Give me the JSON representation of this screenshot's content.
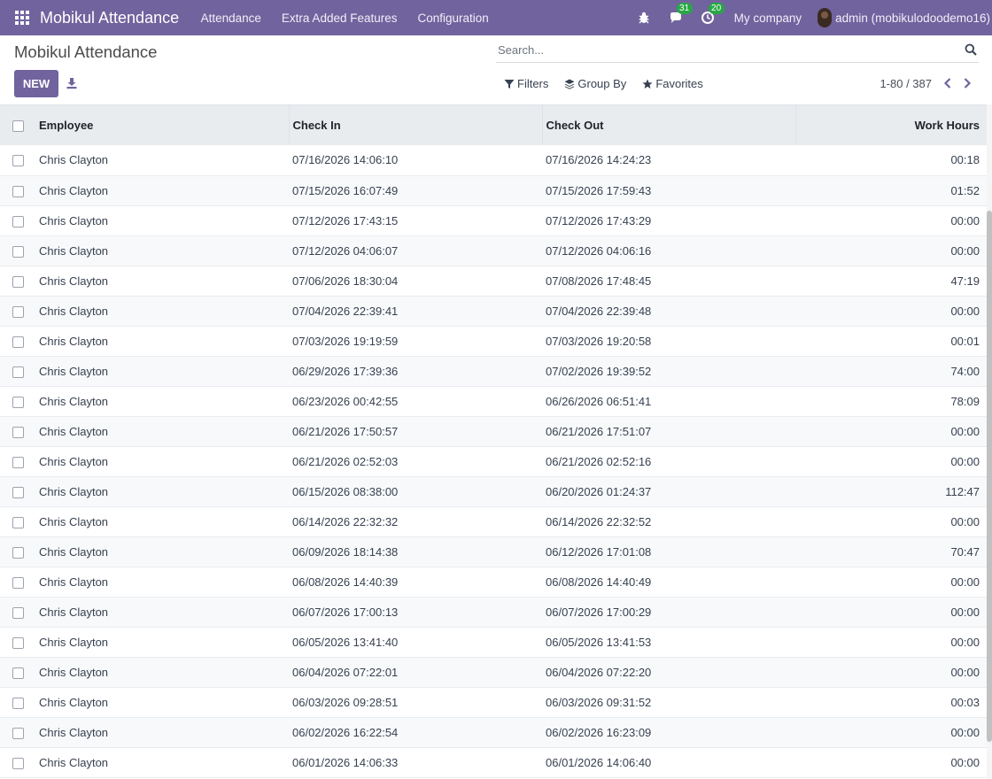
{
  "navbar": {
    "brand": "Mobikul Attendance",
    "menu": [
      "Attendance",
      "Extra Added Features",
      "Configuration"
    ],
    "messages_badge": "31",
    "activities_badge": "20",
    "company": "My company",
    "user": "admin (mobikulodoodemo16)",
    "icons": [
      "apps-grid-icon",
      "bug-icon",
      "chat-icon",
      "clock-icon"
    ],
    "color": "#71639e"
  },
  "control_panel": {
    "title": "Mobikul Attendance",
    "new_label": "NEW",
    "search_placeholder": "Search...",
    "filters_label": "Filters",
    "group_by_label": "Group By",
    "favorites_label": "Favorites",
    "pager": "1-80 / 387"
  },
  "table": {
    "columns": [
      "Employee",
      "Check In",
      "Check Out",
      "Work Hours"
    ],
    "rows": [
      [
        "Chris Clayton",
        "07/16/2026 14:06:10",
        "07/16/2026 14:24:23",
        "00:18"
      ],
      [
        "Chris Clayton",
        "07/15/2026 16:07:49",
        "07/15/2026 17:59:43",
        "01:52"
      ],
      [
        "Chris Clayton",
        "07/12/2026 17:43:15",
        "07/12/2026 17:43:29",
        "00:00"
      ],
      [
        "Chris Clayton",
        "07/12/2026 04:06:07",
        "07/12/2026 04:06:16",
        "00:00"
      ],
      [
        "Chris Clayton",
        "07/06/2026 18:30:04",
        "07/08/2026 17:48:45",
        "47:19"
      ],
      [
        "Chris Clayton",
        "07/04/2026 22:39:41",
        "07/04/2026 22:39:48",
        "00:00"
      ],
      [
        "Chris Clayton",
        "07/03/2026 19:19:59",
        "07/03/2026 19:20:58",
        "00:01"
      ],
      [
        "Chris Clayton",
        "06/29/2026 17:39:36",
        "07/02/2026 19:39:52",
        "74:00"
      ],
      [
        "Chris Clayton",
        "06/23/2026 00:42:55",
        "06/26/2026 06:51:41",
        "78:09"
      ],
      [
        "Chris Clayton",
        "06/21/2026 17:50:57",
        "06/21/2026 17:51:07",
        "00:00"
      ],
      [
        "Chris Clayton",
        "06/21/2026 02:52:03",
        "06/21/2026 02:52:16",
        "00:00"
      ],
      [
        "Chris Clayton",
        "06/15/2026 08:38:00",
        "06/20/2026 01:24:37",
        "112:47"
      ],
      [
        "Chris Clayton",
        "06/14/2026 22:32:32",
        "06/14/2026 22:32:52",
        "00:00"
      ],
      [
        "Chris Clayton",
        "06/09/2026 18:14:38",
        "06/12/2026 17:01:08",
        "70:47"
      ],
      [
        "Chris Clayton",
        "06/08/2026 14:40:39",
        "06/08/2026 14:40:49",
        "00:00"
      ],
      [
        "Chris Clayton",
        "06/07/2026 17:00:13",
        "06/07/2026 17:00:29",
        "00:00"
      ],
      [
        "Chris Clayton",
        "06/05/2026 13:41:40",
        "06/05/2026 13:41:53",
        "00:00"
      ],
      [
        "Chris Clayton",
        "06/04/2026 07:22:01",
        "06/04/2026 07:22:20",
        "00:00"
      ],
      [
        "Chris Clayton",
        "06/03/2026 09:28:51",
        "06/03/2026 09:31:52",
        "00:03"
      ],
      [
        "Chris Clayton",
        "06/02/2026 16:22:54",
        "06/02/2026 16:23:09",
        "00:00"
      ],
      [
        "Chris Clayton",
        "06/01/2026 14:06:33",
        "06/01/2026 14:06:40",
        "00:00"
      ]
    ]
  }
}
